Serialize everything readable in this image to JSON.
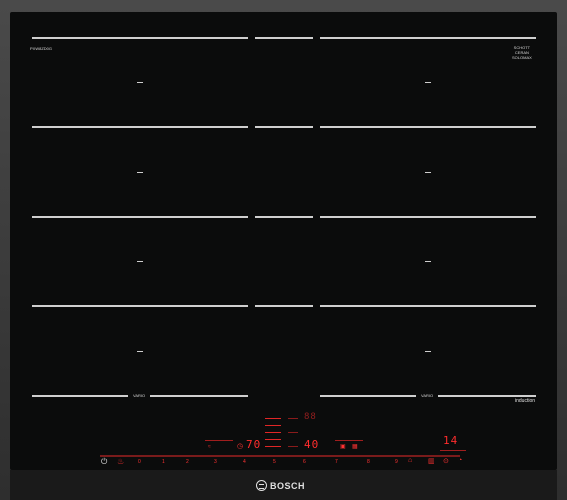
{
  "model": {
    "label": "PXW8ZD0G"
  },
  "schott": {
    "line1": "SCHOTT",
    "line2": "CERAN",
    "line3": "SOLOMAX"
  },
  "zones": {
    "induction_label": "induction",
    "vari_left": "VARIO",
    "vari_right": "VARIO"
  },
  "display": {
    "left_value": "70",
    "center_value": "40",
    "right_value": "14"
  },
  "slider": {
    "numbers": [
      "0",
      "1",
      "2",
      "3",
      "4",
      "5",
      "6",
      "7",
      "8",
      "9"
    ]
  },
  "brand": {
    "name": "BOSCH"
  },
  "colors": {
    "glass": "#0b0c0c",
    "accent": "#e02626",
    "frame": "#3a3a3a"
  }
}
